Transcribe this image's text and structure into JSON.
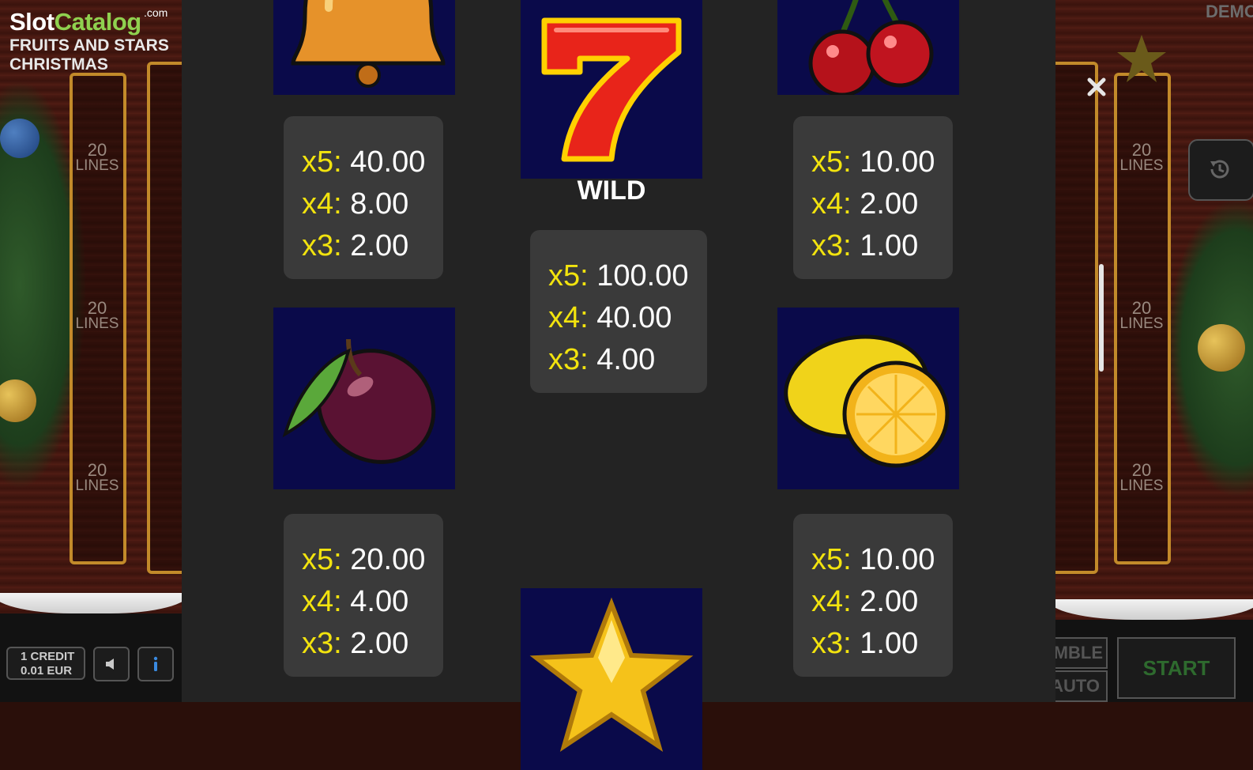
{
  "logo": {
    "brand_a": "Slot",
    "brand_b": "Catalog",
    "com": ".com",
    "title_line1": "FRUITS AND STARS",
    "title_line2": "CHRISTMAS"
  },
  "reels": {
    "lines_num": "20",
    "lines_word": "LINES"
  },
  "bottom_left": {
    "credit_line1": "1 CREDIT",
    "credit_line2": "0.01 EUR"
  },
  "top_right": {
    "demo": "DEMO"
  },
  "bottom_right": {
    "gamble": "GAMBLE",
    "auto": "AUTO",
    "start": "START"
  },
  "paytable": {
    "wild_label": "WILD",
    "symbols": [
      {
        "name": "bell",
        "rows": [
          {
            "mult": "x5:",
            "value": "40.00"
          },
          {
            "mult": "x4:",
            "value": "8.00"
          },
          {
            "mult": "x3:",
            "value": "2.00"
          }
        ]
      },
      {
        "name": "seven",
        "rows": [
          {
            "mult": "x5:",
            "value": "100.00"
          },
          {
            "mult": "x4:",
            "value": "40.00"
          },
          {
            "mult": "x3:",
            "value": "4.00"
          }
        ]
      },
      {
        "name": "cherry",
        "rows": [
          {
            "mult": "x5:",
            "value": "10.00"
          },
          {
            "mult": "x4:",
            "value": "2.00"
          },
          {
            "mult": "x3:",
            "value": "1.00"
          }
        ]
      },
      {
        "name": "plum",
        "rows": [
          {
            "mult": "x5:",
            "value": "20.00"
          },
          {
            "mult": "x4:",
            "value": "4.00"
          },
          {
            "mult": "x3:",
            "value": "2.00"
          }
        ]
      },
      {
        "name": "lemon",
        "rows": [
          {
            "mult": "x5:",
            "value": "10.00"
          },
          {
            "mult": "x4:",
            "value": "2.00"
          },
          {
            "mult": "x3:",
            "value": "1.00"
          }
        ]
      },
      {
        "name": "star"
      }
    ]
  },
  "colors": {
    "multiplier": "#f2e30e",
    "panel": "#232323",
    "payout_box": "#3a3a3a",
    "symbol_tile": "#0a0a4a"
  }
}
